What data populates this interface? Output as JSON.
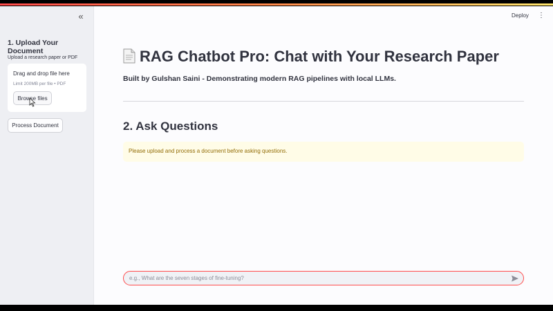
{
  "sidebar": {
    "collapse_glyph": "«",
    "section_title": "1. Upload Your Document",
    "upload_label": "Upload a research paper or PDF",
    "dropzone": {
      "title": "Drag and drop file here",
      "limit": "Limit 200MB per file • PDF",
      "browse_label": "Browse files"
    },
    "process_label": "Process Document"
  },
  "header": {
    "deploy_label": "Deploy",
    "menu_glyph": "⋮"
  },
  "main": {
    "title": "RAG Chatbot Pro: Chat with Your Research Paper",
    "subtitle": "Built by Gulshan Saini - Demonstrating modern RAG pipelines with local LLMs.",
    "section_title": "2. Ask Questions",
    "alert_text": "Please upload and process a document before asking questions.",
    "chat_placeholder": "e.g., What are the seven stages of fine-tuning?"
  },
  "colors": {
    "accent": "#ff4b4b",
    "alert_bg": "#fffce7",
    "alert_text": "#926c05",
    "sidebar_bg": "#eeeff3"
  },
  "icons": [
    "chevron-double-left-icon",
    "document-icon",
    "kebab-menu-icon",
    "send-icon",
    "mouse-pointer-icon"
  ]
}
